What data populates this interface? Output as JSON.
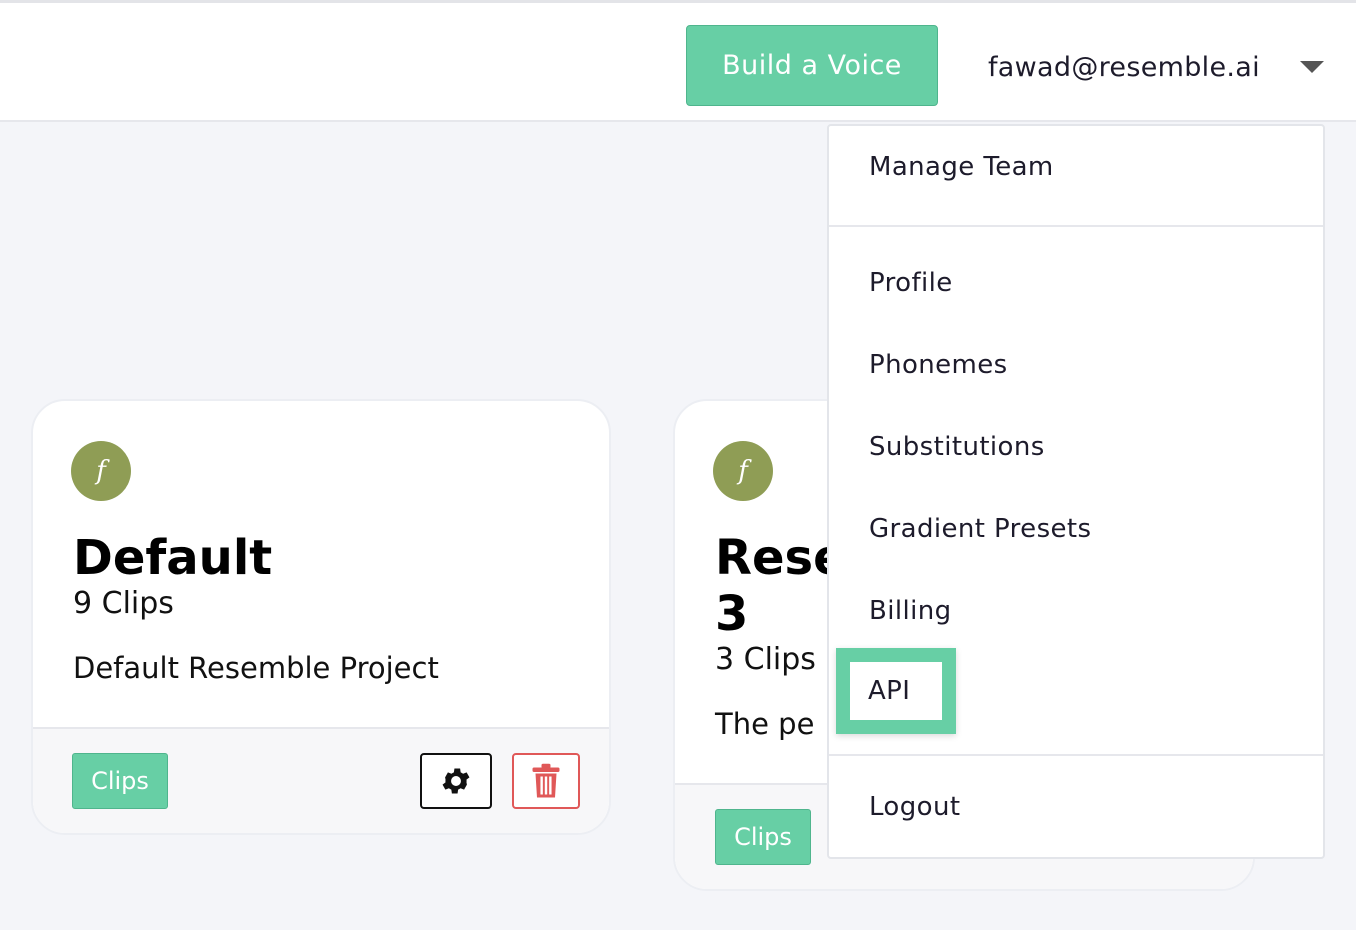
{
  "header": {
    "build_button_label": "Build a Voice",
    "user_email": "fawad@resemble.ai"
  },
  "projects": [
    {
      "avatar_letter": "f",
      "title": "Default",
      "clips": "9 Clips",
      "description": "Default Resemble Project",
      "clips_button": "Clips"
    },
    {
      "avatar_letter": "f",
      "title_line1": "Rese",
      "title_line2": "3",
      "clips": "3 Clips",
      "description": "The pe",
      "clips_button": "Clips"
    }
  ],
  "dropdown": {
    "manage_team": "Manage Team",
    "profile": "Profile",
    "phonemes": "Phonemes",
    "substitutions": "Substitutions",
    "gradient_presets": "Gradient Presets",
    "billing": "Billing",
    "api": "API",
    "logout": "Logout"
  },
  "colors": {
    "accent": "#67cfa5",
    "avatar": "#8f9d55",
    "danger": "#e05858"
  }
}
